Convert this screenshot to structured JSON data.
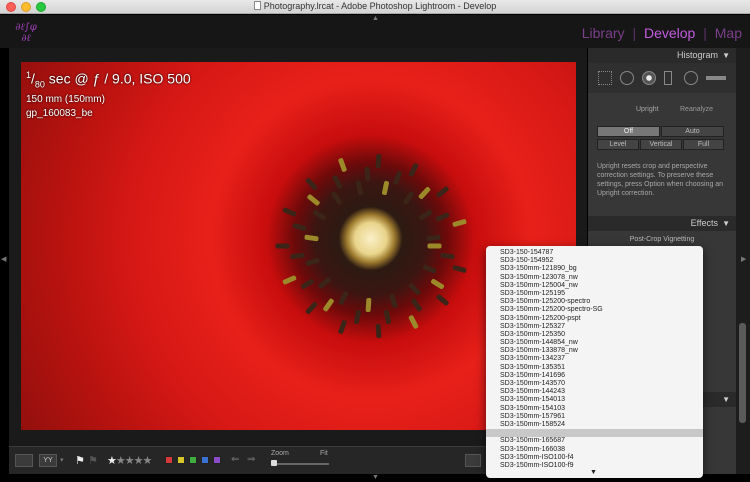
{
  "window": {
    "title": "Photography.lrcat - Adobe Photoshop Lightroom - Develop"
  },
  "topbar": {
    "modules": [
      {
        "label": "Library",
        "active": false
      },
      {
        "label": "Develop",
        "active": true
      },
      {
        "label": "Map",
        "active": false
      }
    ],
    "separator": "|"
  },
  "photo": {
    "overlay": {
      "exposure_num": "1",
      "exposure_den": "80",
      "exposure_rest": " sec @ ƒ / 9.0, ISO 500",
      "focal": "150 mm (150mm)",
      "filename": "gp_160083_be"
    }
  },
  "toolbar": {
    "rating": 1,
    "rating_max": 5,
    "color_labels": [
      "#d43a3a",
      "#d8c52a",
      "#3fae3f",
      "#3a72d4",
      "#8c4cc8"
    ],
    "zoom_label": "Zoom",
    "fit_label": "Fit"
  },
  "right_panel": {
    "histogram_label": "Histogram",
    "upright_label": "Upright",
    "reanalyze_label": "Reanalyze",
    "off_label": "Off",
    "auto_label": "Auto",
    "level_label": "Level",
    "vertical_label": "Vertical",
    "full_label": "Full",
    "upright_help": "Upright resets crop and perspective correction settings. To preserve these settings, press Option when choosing an Upright correction.",
    "effects_label": "Effects",
    "vignetting_label": "Post-Crop Vignetting"
  },
  "preset_menu": {
    "items": [
      "SD3-150-154787",
      "SD3-150-154952",
      "SD3-150mm-121890_bg",
      "SD3-150mm-123078_nw",
      "SD3-150mm-125004_nw",
      "SD3-150mm-125195",
      "SD3-150mm-125200-spectro",
      "SD3-150mm-125200-spectro-SG",
      "SD3-150mm-125200-pspt",
      "SD3-150mm-125327",
      "SD3-150mm-125350",
      "SD3-150mm-144854_nw",
      "SD3-150mm-133878_nw",
      "SD3-150mm-134237",
      "SD3-150mm-135351",
      "SD3-150mm-141696",
      "SD3-150mm-143570",
      "SD3-150mm-144243",
      "SD3-150mm-154013",
      "SD3-150mm-154103",
      "SD3-150mm-157961",
      "SD3-150mm-158524",
      "",
      "SD3-150mm-165687",
      "SD3-150mm-166038",
      "SD3-150mm-ISO100-f4",
      "SD3-150mm-ISO100-f9"
    ],
    "highlighted_index": 22,
    "more_arrow": "▼"
  }
}
